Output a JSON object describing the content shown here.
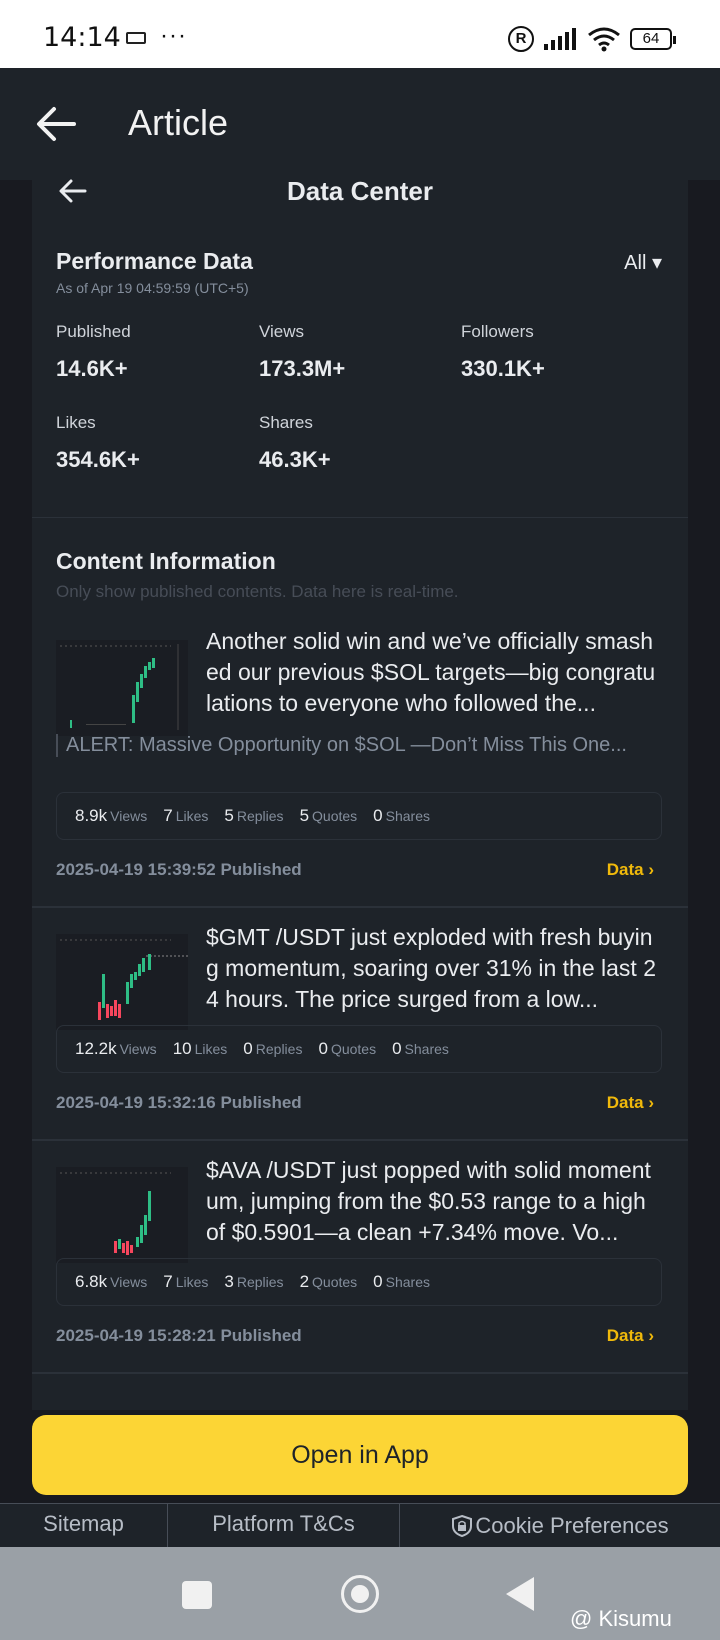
{
  "status_bar": {
    "time": "14:14",
    "dots": "···",
    "reg": "R",
    "battery": "64"
  },
  "app_bar": {
    "title": "Article"
  },
  "data_center": {
    "title": "Data Center",
    "performance": {
      "title": "Performance Data",
      "as_of": "As of Apr 19 04:59:59 (UTC+5)",
      "filter": "All ▾",
      "stats": [
        {
          "label": "Published",
          "value": "14.6K+"
        },
        {
          "label": "Views",
          "value": "173.3M+"
        },
        {
          "label": "Followers",
          "value": "330.1K+"
        },
        {
          "label": "Likes",
          "value": "354.6K+"
        },
        {
          "label": "Shares",
          "value": "46.3K+"
        }
      ]
    },
    "content": {
      "title": "Content Information",
      "subtitle": "Only show published contents. Data here is real-time.",
      "items": [
        {
          "text": "Another solid win and we’ve officially smashed our previous $SOL targets—big congratulations to everyone who followed the...",
          "alert": "ALERT: Massive Opportunity on $SOL —Don’t Miss This One...",
          "views": "8.9k",
          "likes": "7",
          "replies": "5",
          "quotes": "5",
          "shares": "0",
          "published": "2025-04-19 15:39:52 Published",
          "data_link": "Data ›"
        },
        {
          "text": "$GMT /USDT just exploded with fresh buying momentum, soaring over 31% in the last 24 hours. The price surged from a low...",
          "views": "12.2k",
          "likes": "10",
          "replies": "0",
          "quotes": "0",
          "shares": "0",
          "published": "2025-04-19 15:32:16 Published",
          "data_link": "Data ›"
        },
        {
          "text": "$AVA /USDT just popped with solid momentum, jumping from the $0.53 range to a high of $0.5901—a clean +7.34% move. Vo...",
          "views": "6.8k",
          "likes": "7",
          "replies": "3",
          "quotes": "2",
          "shares": "0",
          "published": "2025-04-19 15:28:21 Published",
          "data_link": "Data ›"
        }
      ],
      "metric_labels": {
        "views": "Views",
        "likes": "Likes",
        "replies": "Replies",
        "quotes": "Quotes",
        "shares": "Shares"
      }
    }
  },
  "open_button": "Open in App",
  "footer": {
    "links": [
      "Sitemap",
      "Platform T&Cs",
      "Cookie Preferences"
    ]
  },
  "watermark": "@ Kisumu",
  "colors": {
    "accent": "#fcd535",
    "link": "#f0b90b",
    "panel": "#1e2329",
    "bg": "#181a20"
  }
}
